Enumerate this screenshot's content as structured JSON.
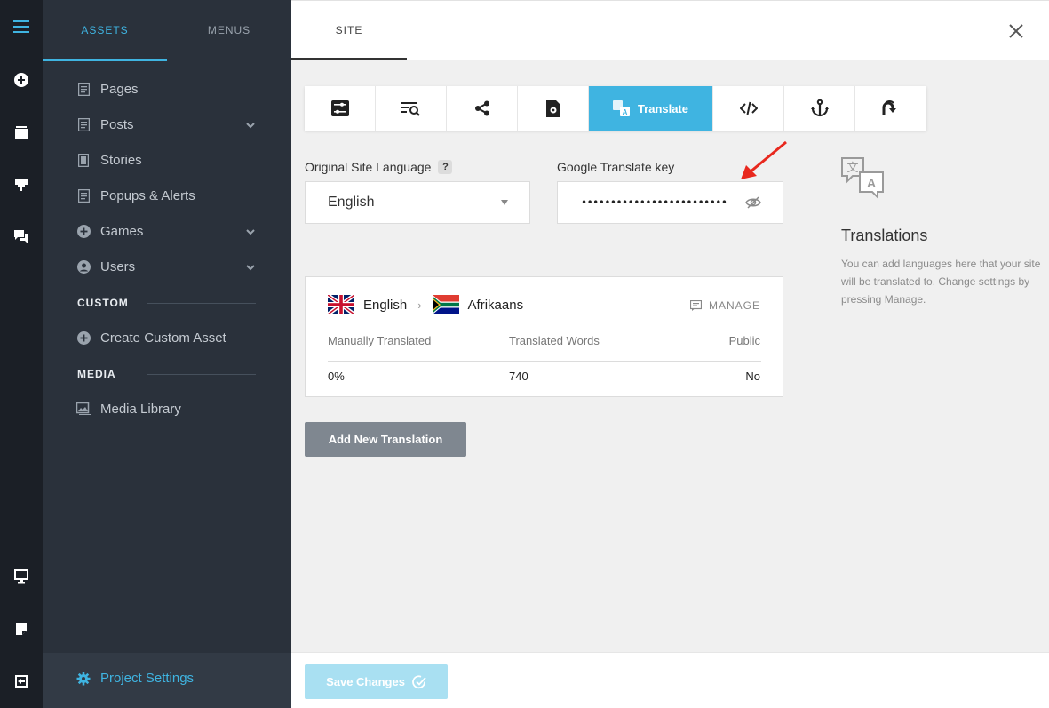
{
  "rail": {
    "icons": [
      "hamburger-menu-icon",
      "add-circle-icon",
      "layers-icon",
      "pin-icon",
      "chat-icon",
      "desktop-icon",
      "note-icon",
      "exit-icon"
    ]
  },
  "sidebar": {
    "tabs": [
      {
        "label": "ASSETS",
        "active": true
      },
      {
        "label": "MENUS",
        "active": false
      }
    ],
    "items": [
      {
        "label": "Pages",
        "icon": "page-icon",
        "has_children": false
      },
      {
        "label": "Posts",
        "icon": "page-icon",
        "has_children": true
      },
      {
        "label": "Stories",
        "icon": "story-icon",
        "has_children": false
      },
      {
        "label": "Popups & Alerts",
        "icon": "page-icon",
        "has_children": false
      },
      {
        "label": "Games",
        "icon": "add-circle-icon",
        "has_children": true
      },
      {
        "label": "Users",
        "icon": "user-circle-icon",
        "has_children": true
      }
    ],
    "custom_section": {
      "label": "CUSTOM",
      "item": "Create Custom Asset"
    },
    "media_section": {
      "label": "MEDIA",
      "item": "Media Library"
    },
    "project_settings": "Project Settings"
  },
  "main": {
    "tab": "SITE",
    "toolbar": {
      "buttons": [
        "settings-sliders-icon",
        "search-list-icon",
        "share-icon",
        "file-gear-icon",
        "translate-icon",
        "code-icon",
        "anchor-icon",
        "redirect-icon"
      ],
      "active_label": "Translate"
    },
    "language": {
      "label": "Original Site Language",
      "help": "?",
      "value": "English"
    },
    "translate_key": {
      "label": "Google Translate key",
      "value": "•••••••••••••••••••••••••"
    },
    "translation": {
      "from": "English",
      "to": "Afrikaans",
      "manage": "MANAGE",
      "columns": [
        "Manually Translated",
        "Translated Words",
        "Public"
      ],
      "values": [
        "0%",
        "740",
        "No"
      ]
    },
    "add_button": "Add New Translation",
    "info": {
      "title": "Translations",
      "description": "You can add languages here that your site will be translated to. Change settings by pressing Manage."
    },
    "save_button": "Save Changes"
  },
  "colors": {
    "accent": "#3fb4e1",
    "sidebar_bg": "#2a313b",
    "rail_bg": "#1b1f26",
    "annotation_arrow": "#e8281e"
  }
}
